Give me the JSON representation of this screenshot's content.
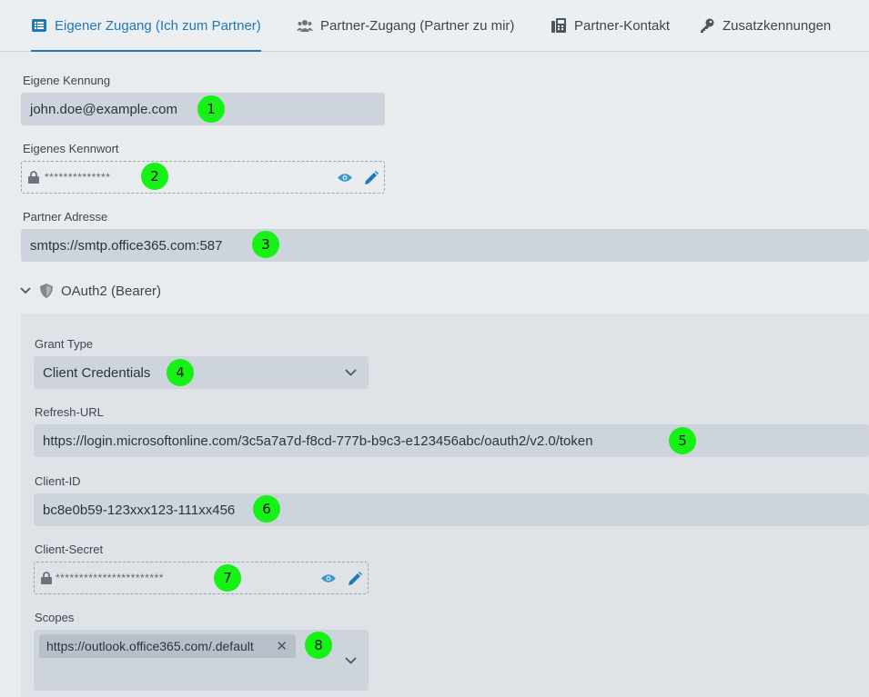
{
  "tabs": [
    {
      "label": "Eigener Zugang (Ich zum Partner)",
      "icon": "list-icon",
      "active": true
    },
    {
      "label": "Partner-Zugang (Partner zu mir)",
      "icon": "users-icon",
      "active": false
    },
    {
      "label": "Partner-Kontakt",
      "icon": "fax-icon",
      "active": false
    },
    {
      "label": "Zusatzkennungen",
      "icon": "key-icon",
      "active": false
    }
  ],
  "own_id": {
    "label": "Eigene Kennung",
    "value": "john.doe@example.com",
    "badge": "1"
  },
  "own_password": {
    "label": "Eigenes Kennwort",
    "value": "**************",
    "badge": "2"
  },
  "partner_address": {
    "label": "Partner Adresse",
    "value": "smtps://smtp.office365.com:587",
    "badge": "3"
  },
  "oauth": {
    "section_title": "OAuth2 (Bearer)",
    "grant_type": {
      "label": "Grant Type",
      "value": "Client Credentials",
      "badge": "4"
    },
    "refresh_url": {
      "label": "Refresh-URL",
      "value": "https://login.microsoftonline.com/3c5a7a7d-f8cd-777b-b9c3-e123456abc/oauth2/v2.0/token",
      "badge": "5"
    },
    "client_id": {
      "label": "Client-ID",
      "value": "bc8e0b59-123xxx123-111xx456",
      "badge": "6"
    },
    "client_secret": {
      "label": "Client-Secret",
      "value": "***********************",
      "badge": "7"
    },
    "scopes": {
      "label": "Scopes",
      "chips": [
        "https://outlook.office365.com/.default"
      ],
      "remove_glyph": "✕",
      "badge": "8"
    }
  },
  "colors": {
    "accent": "#1d79b8",
    "badge": "#16f216",
    "field_bg": "#cdd4db"
  }
}
